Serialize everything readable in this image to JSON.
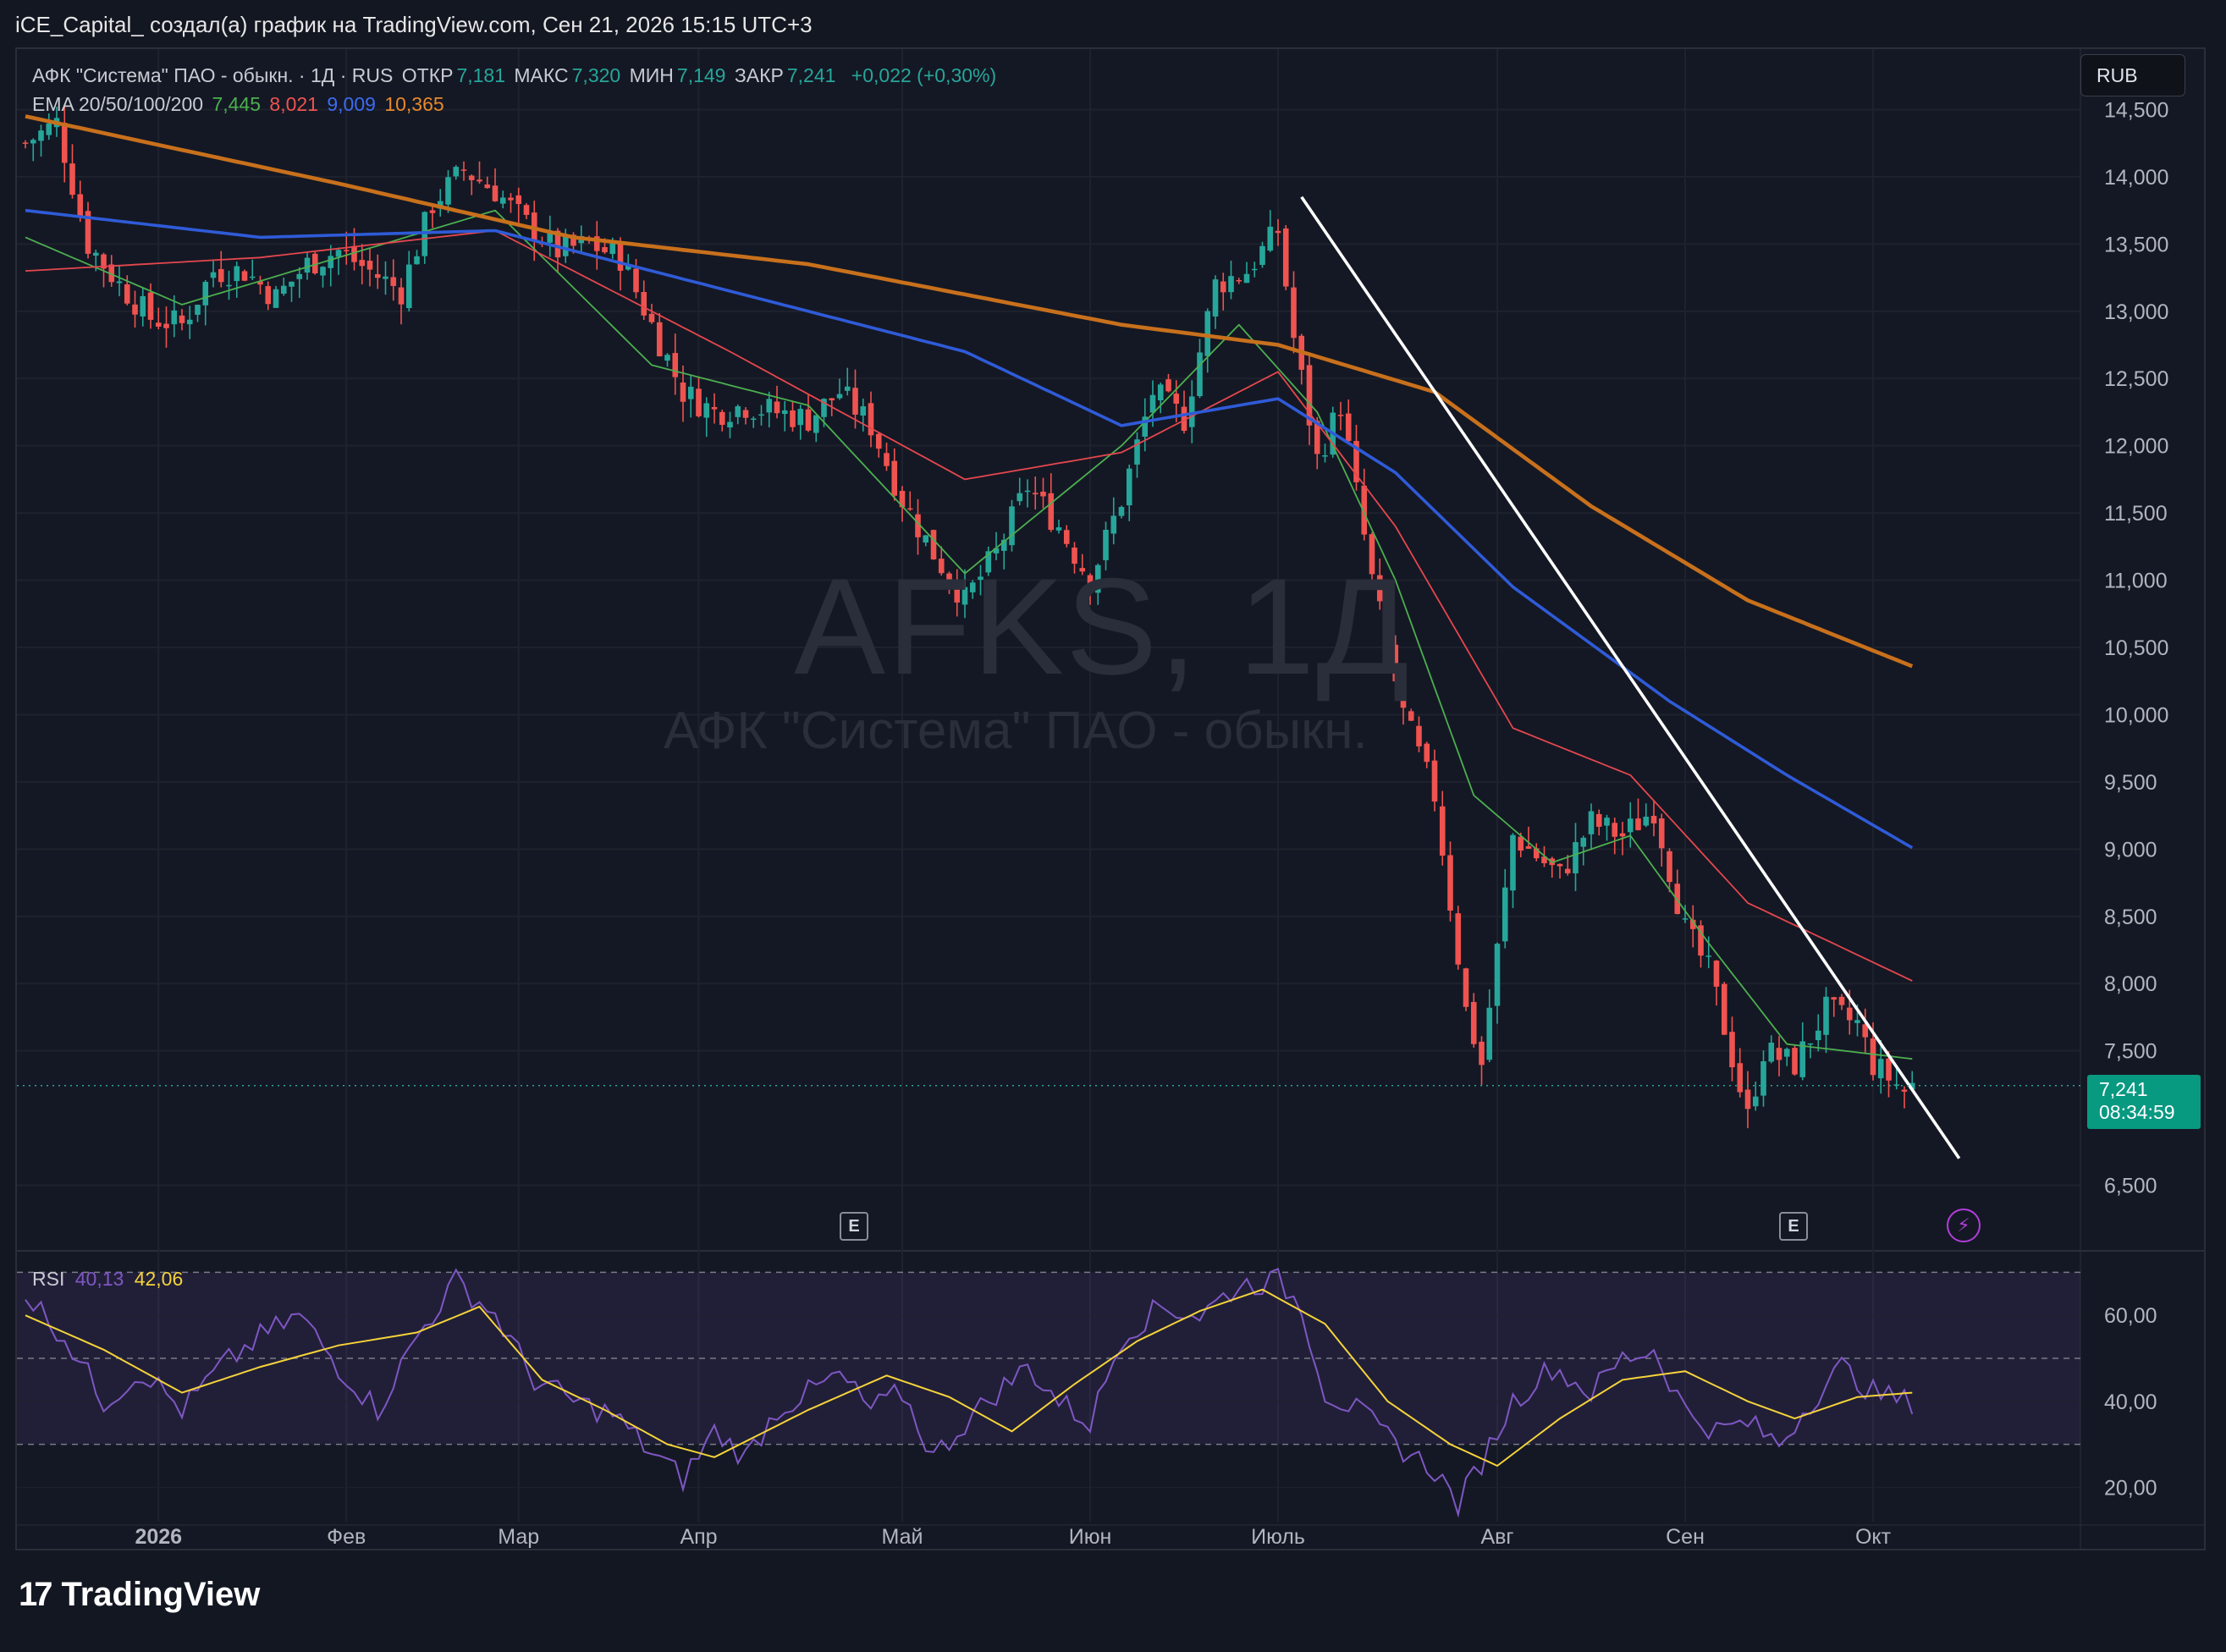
{
  "header": {
    "attribution": "iCE_Capital_ создал(а) график на TradingView.com, Сен 21, 2026 15:15 UTC+3"
  },
  "legend": {
    "symbol": "АФК \"Система\" ПАО - обыкн. · 1Д · RUS",
    "open_label": "ОТКР",
    "open": "7,181",
    "high_label": "МАКС",
    "high": "7,320",
    "low_label": "МИН",
    "low": "7,149",
    "close_label": "ЗАКР",
    "close": "7,241",
    "change": "+0,022 (+0,30%)",
    "ema_label": "EMA 20/50/100/200",
    "ema20": "7,445",
    "ema50": "8,021",
    "ema100": "9,009",
    "ema200": "10,365"
  },
  "currency": "RUB",
  "watermark": {
    "ticker": "AFKS, 1Д",
    "name": "АФК \"Система\" ПАО - обыкн."
  },
  "price_tag": {
    "value": "7,241",
    "countdown": "08:34:59"
  },
  "event_badge": "E",
  "rsi_legend": {
    "label": "RSI",
    "rsi": "40,13",
    "ma": "42,06"
  },
  "branding": {
    "name": "TradingView"
  },
  "colors": {
    "up": "#26a69a",
    "down": "#ef5350",
    "ema20": "#4caf50",
    "ema50": "#e5474e",
    "ema100": "#2f5bd8",
    "ema200": "#c8701c",
    "rsi": "#7e57c2",
    "rsi_ma": "#f5d33a",
    "trendline": "#ffffff"
  },
  "chart_data": {
    "type": "candlestick",
    "title": "АФК \"Система\" ПАО - обыкн. · 1Д · RUS",
    "price_axis": {
      "ticks": [
        "14,500",
        "14,000",
        "13,500",
        "13,000",
        "12,500",
        "12,000",
        "11,500",
        "11,000",
        "10,500",
        "10,000",
        "9,500",
        "9,000",
        "8,500",
        "8,000",
        "7,500",
        "6,500"
      ],
      "range": [
        6.05,
        14.95
      ]
    },
    "time_axis": {
      "labels": [
        "2026",
        "Фев",
        "Мар",
        "Апр",
        "Май",
        "Июн",
        "Июль",
        "Авг",
        "Сен",
        "Окт"
      ],
      "bold": "2026"
    },
    "close_anchors": [
      [
        0,
        14.25
      ],
      [
        4,
        14.4
      ],
      [
        8,
        13.5
      ],
      [
        12,
        13.2
      ],
      [
        16,
        12.95
      ],
      [
        20,
        12.9
      ],
      [
        24,
        13.3
      ],
      [
        28,
        13.3
      ],
      [
        32,
        13.1
      ],
      [
        36,
        13.35
      ],
      [
        40,
        13.45
      ],
      [
        44,
        13.3
      ],
      [
        48,
        13.15
      ],
      [
        52,
        13.8
      ],
      [
        56,
        14.05
      ],
      [
        60,
        13.9
      ],
      [
        64,
        13.65
      ],
      [
        68,
        13.45
      ],
      [
        72,
        13.5
      ],
      [
        76,
        13.4
      ],
      [
        80,
        12.9
      ],
      [
        84,
        12.4
      ],
      [
        88,
        12.25
      ],
      [
        92,
        12.3
      ],
      [
        96,
        12.25
      ],
      [
        100,
        12.2
      ],
      [
        104,
        12.4
      ],
      [
        108,
        12.15
      ],
      [
        112,
        11.6
      ],
      [
        116,
        11.2
      ],
      [
        120,
        10.85
      ],
      [
        124,
        11.2
      ],
      [
        128,
        11.7
      ],
      [
        132,
        11.4
      ],
      [
        136,
        11.0
      ],
      [
        140,
        11.6
      ],
      [
        144,
        12.4
      ],
      [
        148,
        12.2
      ],
      [
        152,
        13.2
      ],
      [
        156,
        13.3
      ],
      [
        160,
        13.6
      ],
      [
        162,
        12.8
      ],
      [
        165,
        11.9
      ],
      [
        168,
        12.3
      ],
      [
        172,
        11.0
      ],
      [
        176,
        10.0
      ],
      [
        180,
        9.4
      ],
      [
        184,
        7.8
      ],
      [
        186,
        7.4
      ],
      [
        190,
        9.1
      ],
      [
        196,
        8.8
      ],
      [
        200,
        9.2
      ],
      [
        204,
        9.1
      ],
      [
        208,
        9.3
      ],
      [
        212,
        8.4
      ],
      [
        215,
        8.1
      ],
      [
        216,
        7.9
      ],
      [
        220,
        7.0
      ],
      [
        222,
        7.5
      ],
      [
        226,
        7.4
      ],
      [
        230,
        7.8
      ],
      [
        234,
        7.7
      ],
      [
        236,
        7.4
      ],
      [
        240,
        7.2
      ],
      [
        241,
        7.24
      ]
    ],
    "ema200_anchors": [
      [
        0,
        14.45
      ],
      [
        40,
        13.95
      ],
      [
        70,
        13.55
      ],
      [
        100,
        13.35
      ],
      [
        140,
        12.9
      ],
      [
        160,
        12.75
      ],
      [
        180,
        12.4
      ],
      [
        200,
        11.55
      ],
      [
        220,
        10.85
      ],
      [
        241,
        10.36
      ]
    ],
    "ema100_anchors": [
      [
        0,
        13.75
      ],
      [
        30,
        13.55
      ],
      [
        60,
        13.6
      ],
      [
        90,
        13.15
      ],
      [
        120,
        12.7
      ],
      [
        140,
        12.15
      ],
      [
        160,
        12.35
      ],
      [
        175,
        11.8
      ],
      [
        190,
        10.95
      ],
      [
        210,
        10.1
      ],
      [
        225,
        9.55
      ],
      [
        241,
        9.01
      ]
    ],
    "ema50_anchors": [
      [
        0,
        13.3
      ],
      [
        30,
        13.4
      ],
      [
        60,
        13.6
      ],
      [
        90,
        12.7
      ],
      [
        120,
        11.75
      ],
      [
        140,
        11.95
      ],
      [
        160,
        12.55
      ],
      [
        175,
        11.4
      ],
      [
        190,
        9.9
      ],
      [
        205,
        9.55
      ],
      [
        220,
        8.6
      ],
      [
        241,
        8.02
      ]
    ],
    "ema20_anchors": [
      [
        0,
        13.55
      ],
      [
        20,
        13.05
      ],
      [
        40,
        13.4
      ],
      [
        60,
        13.75
      ],
      [
        80,
        12.6
      ],
      [
        100,
        12.3
      ],
      [
        120,
        11.05
      ],
      [
        140,
        12.0
      ],
      [
        155,
        12.9
      ],
      [
        165,
        12.25
      ],
      [
        175,
        11.0
      ],
      [
        185,
        9.4
      ],
      [
        195,
        8.9
      ],
      [
        205,
        9.1
      ],
      [
        215,
        8.3
      ],
      [
        225,
        7.55
      ],
      [
        241,
        7.44
      ]
    ],
    "trendline": {
      "x_bars": [
        163,
        247
      ],
      "prices": [
        13.85,
        6.7
      ]
    },
    "rsi": {
      "ticks": [
        "60,00",
        "40,00",
        "20,00"
      ],
      "levels": {
        "upper": 70,
        "middle": 50,
        "lower": 30
      },
      "range": [
        12,
        75
      ],
      "anchors": [
        [
          0,
          65
        ],
        [
          5,
          55
        ],
        [
          10,
          40
        ],
        [
          15,
          47
        ],
        [
          20,
          38
        ],
        [
          25,
          48
        ],
        [
          30,
          55
        ],
        [
          35,
          60
        ],
        [
          40,
          48
        ],
        [
          45,
          38
        ],
        [
          50,
          55
        ],
        [
          55,
          68
        ],
        [
          60,
          60
        ],
        [
          65,
          45
        ],
        [
          70,
          40
        ],
        [
          75,
          37
        ],
        [
          80,
          28
        ],
        [
          84,
          22
        ],
        [
          88,
          33
        ],
        [
          92,
          27
        ],
        [
          96,
          38
        ],
        [
          100,
          42
        ],
        [
          104,
          46
        ],
        [
          108,
          38
        ],
        [
          112,
          42
        ],
        [
          116,
          27
        ],
        [
          120,
          35
        ],
        [
          124,
          42
        ],
        [
          128,
          48
        ],
        [
          132,
          40
        ],
        [
          136,
          35
        ],
        [
          140,
          55
        ],
        [
          145,
          62
        ],
        [
          150,
          60
        ],
        [
          155,
          67
        ],
        [
          160,
          68
        ],
        [
          163,
          62
        ],
        [
          166,
          42
        ],
        [
          170,
          38
        ],
        [
          175,
          30
        ],
        [
          180,
          24
        ],
        [
          183,
          16
        ],
        [
          186,
          26
        ],
        [
          190,
          40
        ],
        [
          195,
          48
        ],
        [
          200,
          42
        ],
        [
          204,
          50
        ],
        [
          208,
          52
        ],
        [
          212,
          38
        ],
        [
          216,
          33
        ],
        [
          220,
          35
        ],
        [
          224,
          30
        ],
        [
          228,
          40
        ],
        [
          232,
          48
        ],
        [
          236,
          42
        ],
        [
          240,
          40
        ],
        [
          241,
          40
        ]
      ],
      "ma_anchors": [
        [
          0,
          60
        ],
        [
          10,
          52
        ],
        [
          20,
          42
        ],
        [
          30,
          48
        ],
        [
          40,
          53
        ],
        [
          50,
          56
        ],
        [
          58,
          62
        ],
        [
          66,
          45
        ],
        [
          74,
          38
        ],
        [
          82,
          30
        ],
        [
          88,
          27
        ],
        [
          100,
          38
        ],
        [
          110,
          46
        ],
        [
          118,
          41
        ],
        [
          126,
          33
        ],
        [
          134,
          44
        ],
        [
          142,
          54
        ],
        [
          150,
          61
        ],
        [
          158,
          66
        ],
        [
          166,
          58
        ],
        [
          174,
          40
        ],
        [
          182,
          30
        ],
        [
          188,
          25
        ],
        [
          196,
          36
        ],
        [
          204,
          45
        ],
        [
          212,
          47
        ],
        [
          220,
          40
        ],
        [
          226,
          36
        ],
        [
          234,
          41
        ],
        [
          241,
          42
        ]
      ]
    }
  }
}
